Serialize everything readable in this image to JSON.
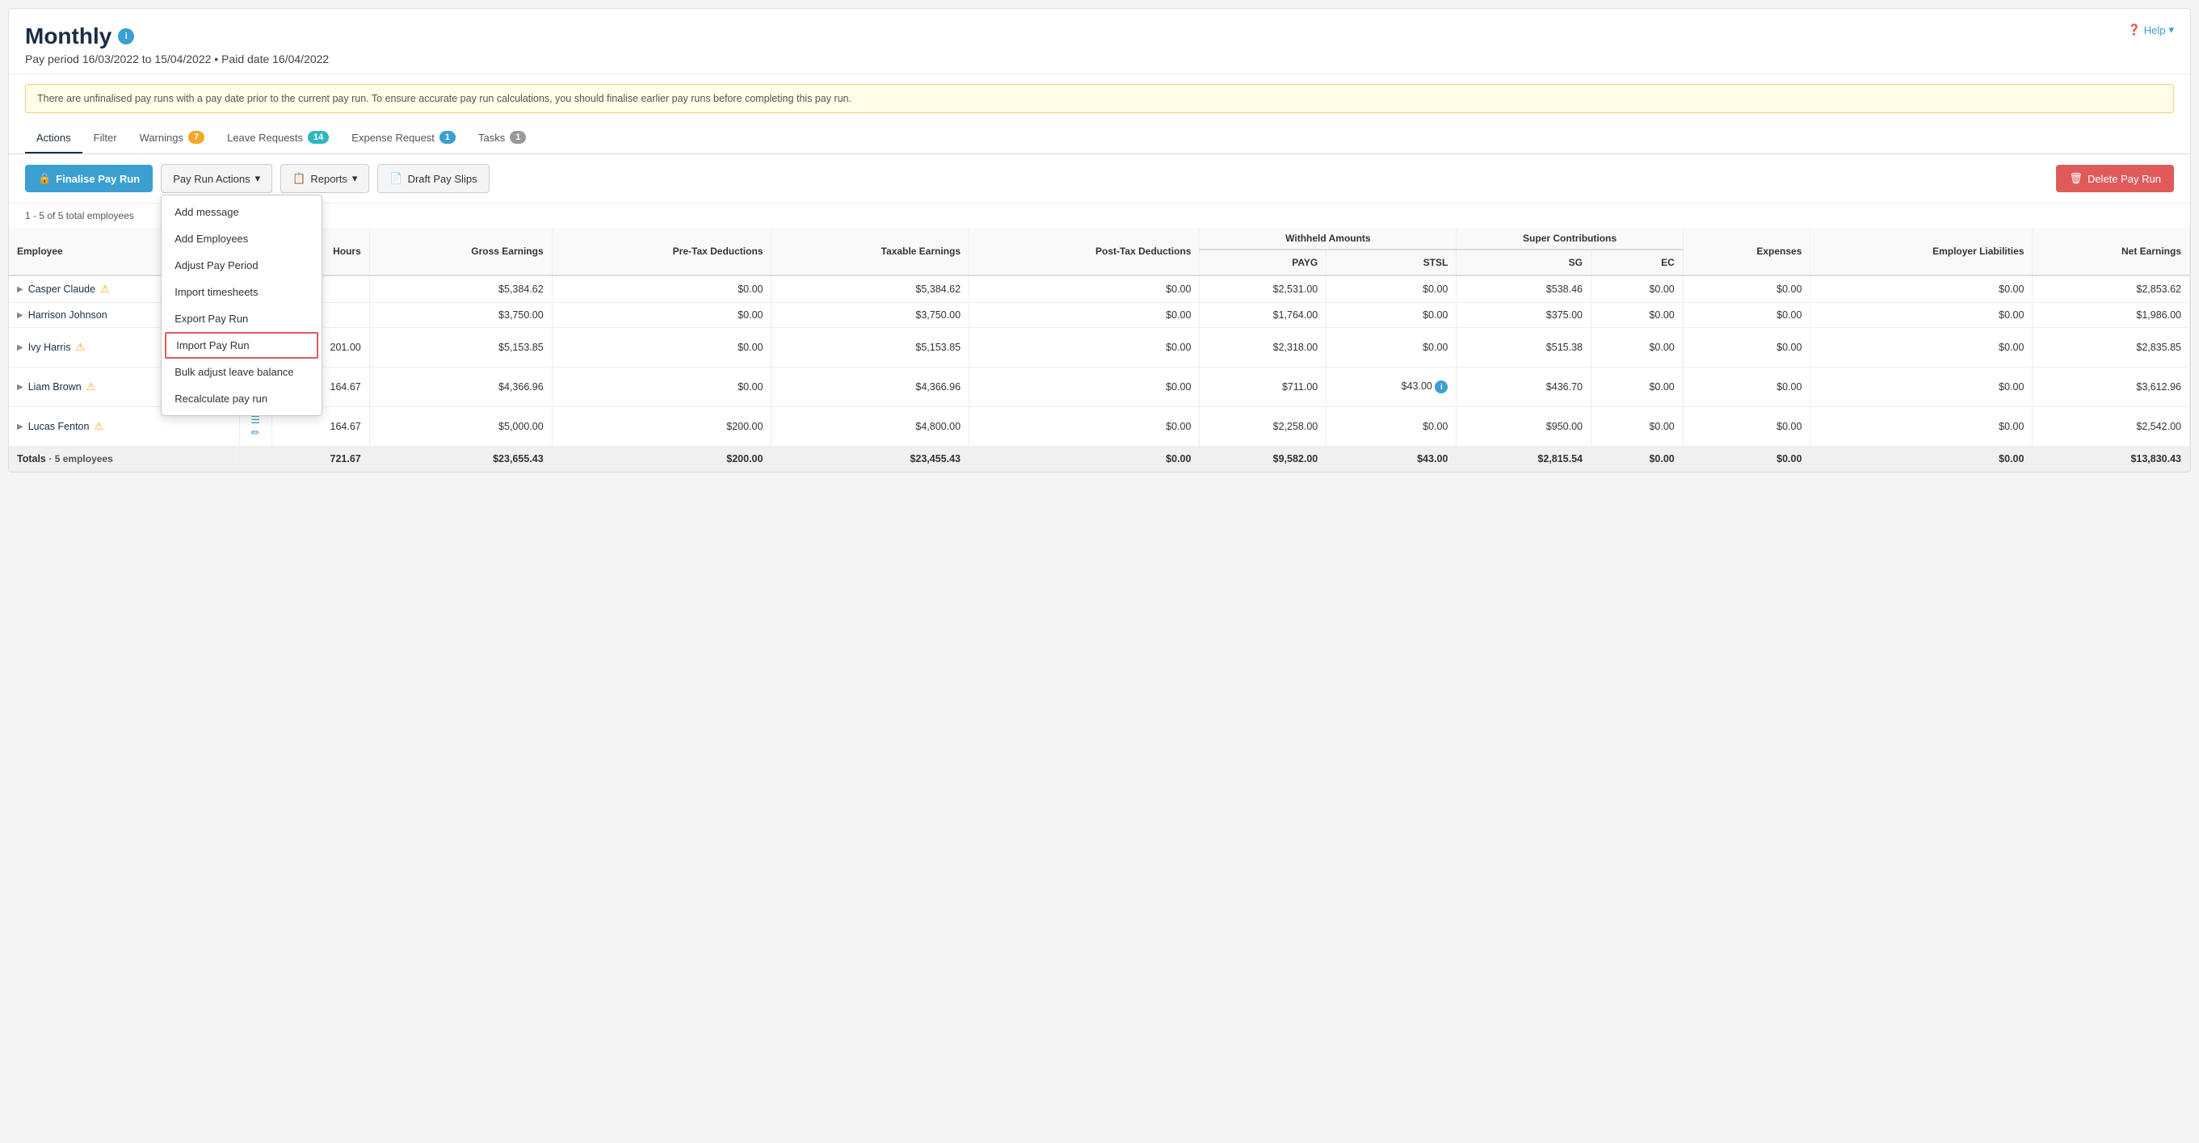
{
  "header": {
    "title": "Monthly",
    "pay_period": "Pay period 16/03/2022 to 15/04/2022 • Paid date 16/04/2022",
    "help_label": "Help"
  },
  "warning": {
    "text": "There are unfinalised pay runs with a pay date prior to the current pay run. To ensure accurate pay run calculations, you should finalise earlier pay runs before completing this pay run."
  },
  "tabs": [
    {
      "label": "Actions",
      "active": true,
      "badge": null,
      "badge_type": null
    },
    {
      "label": "Filter",
      "active": false,
      "badge": null,
      "badge_type": null
    },
    {
      "label": "Warnings",
      "active": false,
      "badge": "7",
      "badge_type": "yellow"
    },
    {
      "label": "Leave Requests",
      "active": false,
      "badge": "14",
      "badge_type": "teal"
    },
    {
      "label": "Expense Request",
      "active": false,
      "badge": "1",
      "badge_type": "blue"
    },
    {
      "label": "Tasks",
      "active": false,
      "badge": "1",
      "badge_type": "gray"
    }
  ],
  "toolbar": {
    "finalise_label": "Finalise Pay Run",
    "actions_label": "Pay Run Actions",
    "reports_label": "Reports",
    "draft_label": "Draft Pay Slips",
    "delete_label": "Delete Pay Run"
  },
  "dropdown": {
    "items": [
      {
        "label": "Add message",
        "highlighted": false
      },
      {
        "label": "Add Employees",
        "highlighted": false
      },
      {
        "label": "Adjust Pay Period",
        "highlighted": false
      },
      {
        "label": "Import timesheets",
        "highlighted": false
      },
      {
        "label": "Export Pay Run",
        "highlighted": false
      },
      {
        "label": "Import Pay Run",
        "highlighted": true
      },
      {
        "label": "Bulk adjust leave balance",
        "highlighted": false
      },
      {
        "label": "Recalculate pay run",
        "highlighted": false
      }
    ]
  },
  "employee_count": "1 - 5 of 5 total employees",
  "table": {
    "columns": {
      "employee": "Employee",
      "hours": "Hours",
      "gross": "Gross Earnings",
      "pre_tax": "Pre-Tax Deductions",
      "taxable": "Taxable Earnings",
      "post_tax": "Post-Tax Deductions",
      "withheld_group": "Withheld Amounts",
      "payg": "PAYG",
      "stsl": "STSL",
      "super_group": "Super Contributions",
      "sg": "SG",
      "ec": "EC",
      "expenses": "Expenses",
      "employer_liabilities": "Employer Liabilities",
      "net_earnings": "Net Earnings"
    },
    "rows": [
      {
        "name": "Casper Claude",
        "warning": true,
        "hours": "",
        "gross": "$5,384.62",
        "pre_tax": "$0.00",
        "taxable": "$5,384.62",
        "post_tax": "$0.00",
        "payg": "$2,531.00",
        "stsl": "$0.00",
        "sg": "$538.46",
        "ec": "$0.00",
        "expenses": "$0.00",
        "employer_liabilities": "$0.00",
        "net": "$2,853.62",
        "stsl_info": false
      },
      {
        "name": "Harrison Johnson",
        "warning": false,
        "hours": "",
        "gross": "$3,750.00",
        "pre_tax": "$0.00",
        "taxable": "$3,750.00",
        "post_tax": "$0.00",
        "payg": "$1,764.00",
        "stsl": "$0.00",
        "sg": "$375.00",
        "ec": "$0.00",
        "expenses": "$0.00",
        "employer_liabilities": "$0.00",
        "net": "$1,986.00",
        "stsl_info": false
      },
      {
        "name": "Ivy Harris",
        "warning": true,
        "hours": "201.00",
        "gross": "$5,153.85",
        "pre_tax": "$0.00",
        "taxable": "$5,153.85",
        "post_tax": "$0.00",
        "payg": "$2,318.00",
        "stsl": "$0.00",
        "sg": "$515.38",
        "ec": "$0.00",
        "expenses": "$0.00",
        "employer_liabilities": "$0.00",
        "net": "$2,835.85",
        "stsl_info": false
      },
      {
        "name": "Liam Brown",
        "warning": true,
        "hours": "164.67",
        "gross": "$4,366.96",
        "pre_tax": "$0.00",
        "taxable": "$4,366.96",
        "post_tax": "$0.00",
        "payg": "$711.00",
        "stsl": "$43.00",
        "sg": "$436.70",
        "ec": "$0.00",
        "expenses": "$0.00",
        "employer_liabilities": "$0.00",
        "net": "$3,612.96",
        "stsl_info": true
      },
      {
        "name": "Lucas Fenton",
        "warning": true,
        "hours": "164.67",
        "gross": "$5,000.00",
        "pre_tax": "$200.00",
        "taxable": "$4,800.00",
        "post_tax": "$0.00",
        "payg": "$2,258.00",
        "stsl": "$0.00",
        "sg": "$950.00",
        "ec": "$0.00",
        "expenses": "$0.00",
        "employer_liabilities": "$0.00",
        "net": "$2,542.00",
        "stsl_info": false
      }
    ],
    "totals": {
      "label": "Totals",
      "sub_label": "5 employees",
      "hours": "721.67",
      "gross": "$23,655.43",
      "pre_tax": "$200.00",
      "taxable": "$23,455.43",
      "post_tax": "$0.00",
      "payg": "$9,582.00",
      "stsl": "$43.00",
      "sg": "$2,815.54",
      "ec": "$0.00",
      "expenses": "$0.00",
      "employer_liabilities": "$0.00",
      "net": "$13,830.43"
    }
  }
}
